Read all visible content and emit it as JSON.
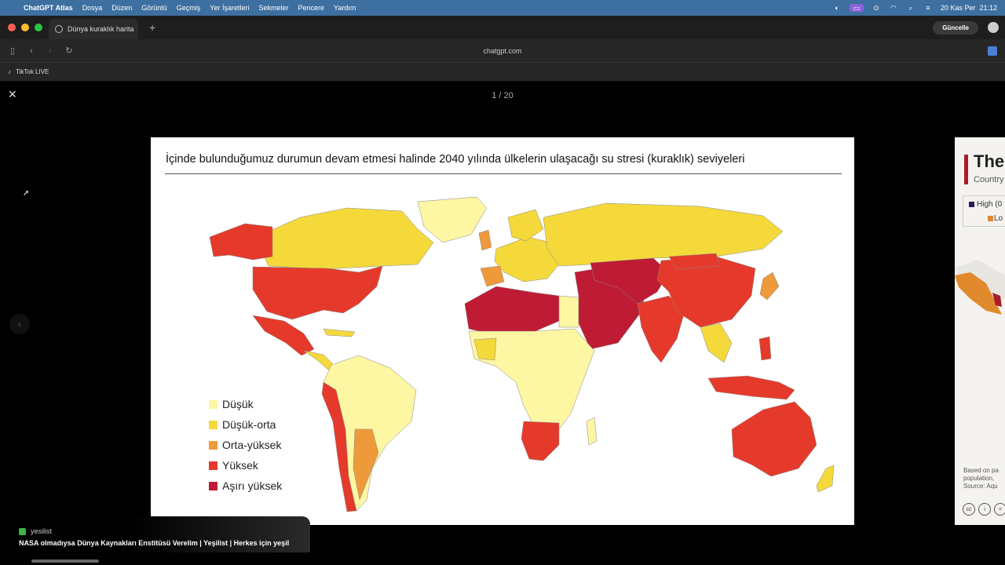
{
  "menubar": {
    "app": "ChatGPT Atlas",
    "items": [
      "Dosya",
      "Düzen",
      "Görüntü",
      "Geçmiş",
      "Yer İşaretleri",
      "Sekmeler",
      "Pencere",
      "Yardım"
    ],
    "clock": "20 Kas Per  21:12"
  },
  "tabs": [
    {
      "title": "Dünya kuraklık harita"
    }
  ],
  "toolbar": {
    "update_label": "Güncelle",
    "url": "chatgpt.com"
  },
  "bookmarks": [
    {
      "label": "TikTok LIVE"
    }
  ],
  "viewer": {
    "counter": "1 / 20",
    "slide": {
      "title": "İçinde bulunduğumuz durumun devam etmesi halinde 2040 yılında ülkelerin ulaşacağı su stresi (kuraklık) seviyeleri",
      "legend": [
        {
          "label": "Düşük",
          "color": "#fdf6a3"
        },
        {
          "label": "Düşük-orta",
          "color": "#f5d93b"
        },
        {
          "label": "Orta-yüksek",
          "color": "#ef9a3a"
        },
        {
          "label": "Yüksek",
          "color": "#e53a2b"
        },
        {
          "label": "Aşırı yüksek",
          "color": "#bf1b34"
        }
      ]
    },
    "next_preview": {
      "title": "The",
      "subtitle": "Country",
      "legend": [
        "High (0",
        "Lo"
      ],
      "footer": "Based on pa\npopulation,\nSource: Aqu"
    }
  },
  "toast": {
    "source": "yesilist",
    "title": "NASA olmadıysa Dünya Kaynakları Enstitüsü Verelim | Yeşilist | Herkes için yeşil"
  }
}
